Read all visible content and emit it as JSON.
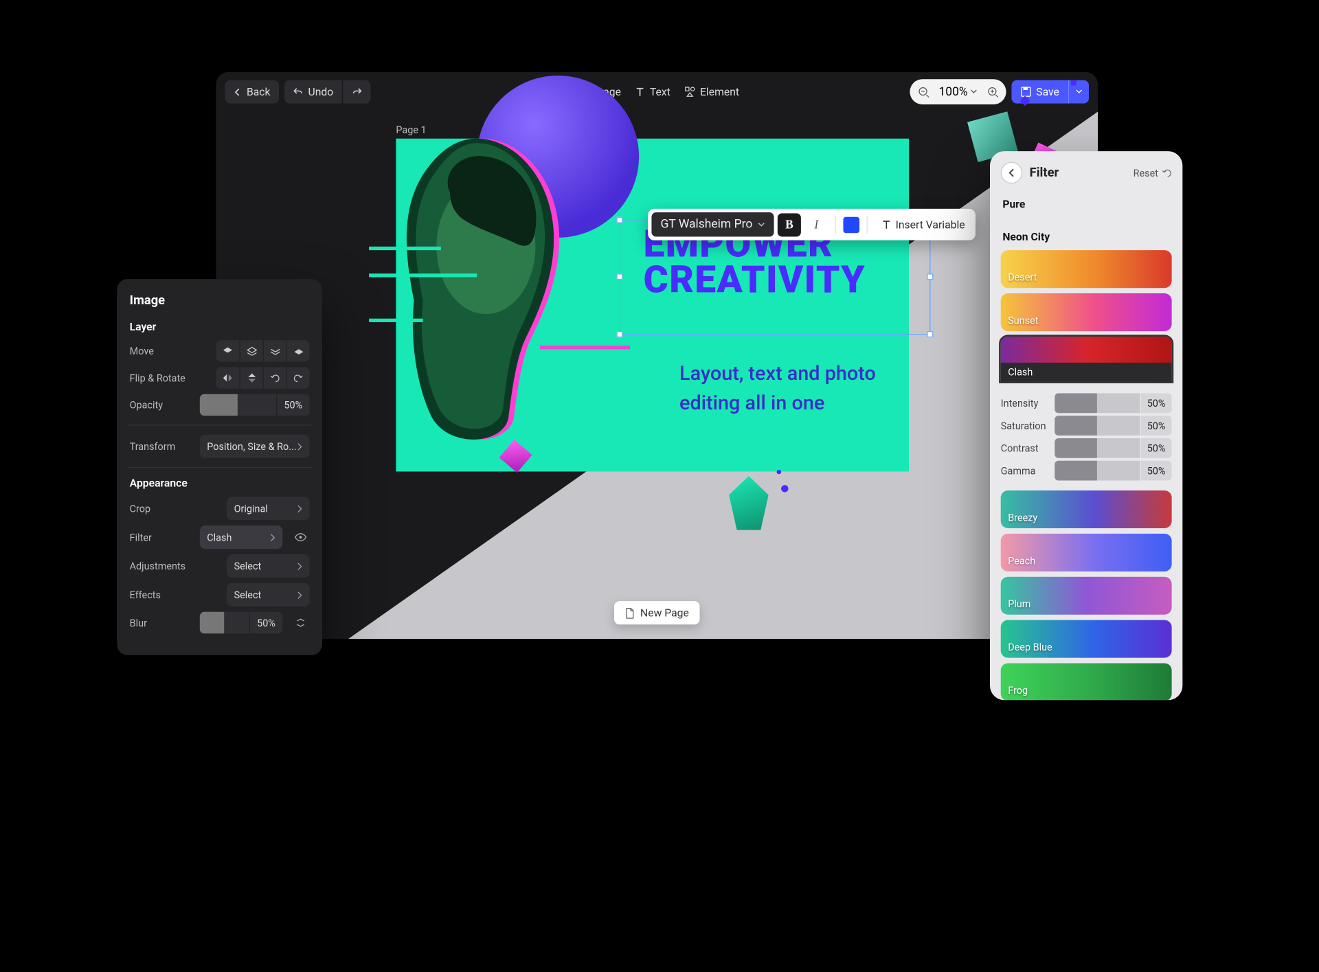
{
  "topbar": {
    "back": "Back",
    "undo": "Undo",
    "image": "Image",
    "text": "Text",
    "element": "Element",
    "zoom": "100%",
    "save": "Save"
  },
  "canvas": {
    "page_label": "Page 1",
    "headline1": "EMPOWER",
    "headline2": "CREATIVITY",
    "subline": "Layout, text and photo editing all in one",
    "new_page": "New Page"
  },
  "text_toolbar": {
    "font": "GT Walsheim Pro",
    "bold": "B",
    "italic": "I",
    "insert": "Insert Variable",
    "color": "#2049ff"
  },
  "image_panel": {
    "title": "Image",
    "section_layer": "Layer",
    "move": "Move",
    "flip_rotate": "Flip & Rotate",
    "opacity": "Opacity",
    "opacity_val": "50%",
    "transform": "Transform",
    "transform_val": "Position, Size & Ro...",
    "section_appearance": "Appearance",
    "crop": "Crop",
    "crop_val": "Original",
    "filter": "Filter",
    "filter_val": "Clash",
    "adjustments": "Adjustments",
    "adjustments_val": "Select",
    "effects": "Effects",
    "effects_val": "Select",
    "blur": "Blur",
    "blur_val": "50%"
  },
  "filter_panel": {
    "title": "Filter",
    "reset": "Reset",
    "group_pure": "Pure",
    "group_neon": "Neon City",
    "sliders": {
      "intensity": {
        "label": "Intensity",
        "value": "50%"
      },
      "saturation": {
        "label": "Saturation",
        "value": "50%"
      },
      "contrast": {
        "label": "Contrast",
        "value": "50%"
      },
      "gamma": {
        "label": "Gamma",
        "value": "50%"
      }
    },
    "filters": {
      "desert": "Desert",
      "sunset": "Sunset",
      "clash": "Clash",
      "breezy": "Breezy",
      "peach": "Peach",
      "plum": "Plum",
      "deepblue": "Deep Blue",
      "frog": "Frog"
    }
  }
}
